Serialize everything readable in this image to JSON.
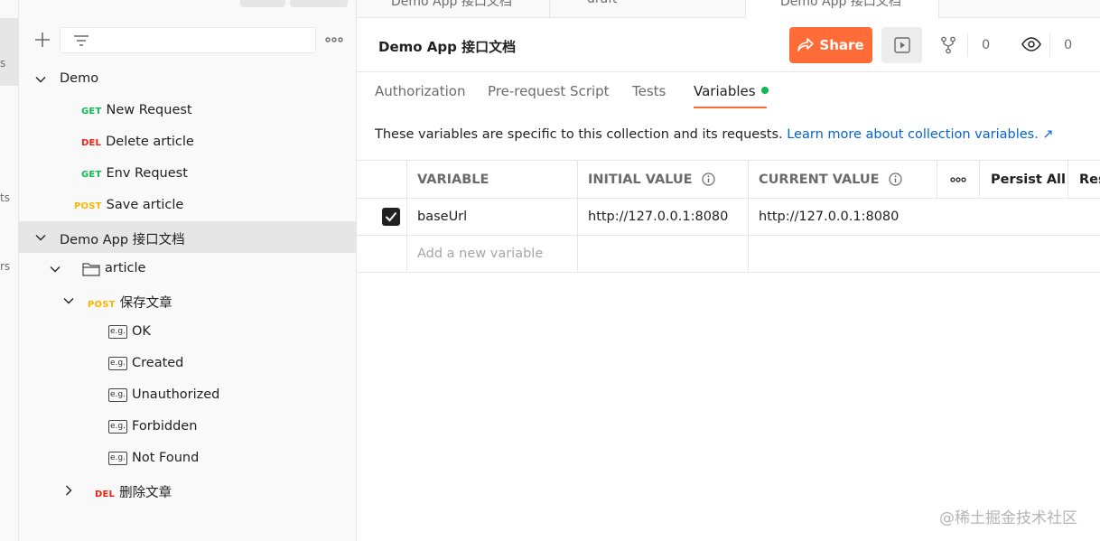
{
  "rail": {
    "labels": [
      "s",
      "ts",
      "rs"
    ]
  },
  "sidebar": {
    "tree": [
      {
        "type": "collection",
        "label": "Demo"
      },
      {
        "method": "GET",
        "label": "New Request"
      },
      {
        "method": "DEL",
        "label": "Delete article"
      },
      {
        "method": "GET",
        "label": "Env Request"
      },
      {
        "method": "POST",
        "label": "Save article"
      },
      {
        "type": "collection",
        "label": "Demo App 接口文档"
      },
      {
        "type": "folder",
        "label": "article"
      },
      {
        "method": "POST",
        "label": "保存文章"
      },
      {
        "type": "example",
        "label": "OK"
      },
      {
        "type": "example",
        "label": "Created"
      },
      {
        "type": "example",
        "label": "Unauthorized"
      },
      {
        "type": "example",
        "label": "Forbidden"
      },
      {
        "type": "example",
        "label": "Not Found"
      },
      {
        "method": "DEL",
        "label": "删除文章"
      }
    ],
    "example_badge": "e.g."
  },
  "tabs": {
    "items": [
      {
        "label": "Demo App 接口文档"
      },
      {
        "label": "draft"
      },
      {
        "label": "Demo App 接口文档"
      }
    ]
  },
  "header": {
    "title": "Demo App 接口文档",
    "share_label": "Share",
    "fork_count": "0",
    "watch_count": "0"
  },
  "subtabs": {
    "authorization": "Authorization",
    "prerequest": "Pre-request Script",
    "tests": "Tests",
    "variables": "Variables"
  },
  "description": {
    "text": "These variables are specific to this collection and its requests.",
    "link": "Learn more about collection variables. ↗"
  },
  "variables_table": {
    "headers": {
      "variable": "VARIABLE",
      "initial": "INITIAL VALUE",
      "current": "CURRENT VALUE",
      "persist_all": "Persist All",
      "reset_all": "Reset All"
    },
    "rows": [
      {
        "checked": true,
        "variable": "baseUrl",
        "initial": "http://127.0.0.1:8080",
        "current": "http://127.0.0.1:8080"
      }
    ],
    "add_placeholder": "Add a new variable"
  },
  "watermark": "@稀土掘金技术社区",
  "colors": {
    "accent": "#ff6c37",
    "get": "#0cbb52",
    "del": "#eb2013",
    "post": "#ffb400",
    "link": "#0265d2"
  }
}
